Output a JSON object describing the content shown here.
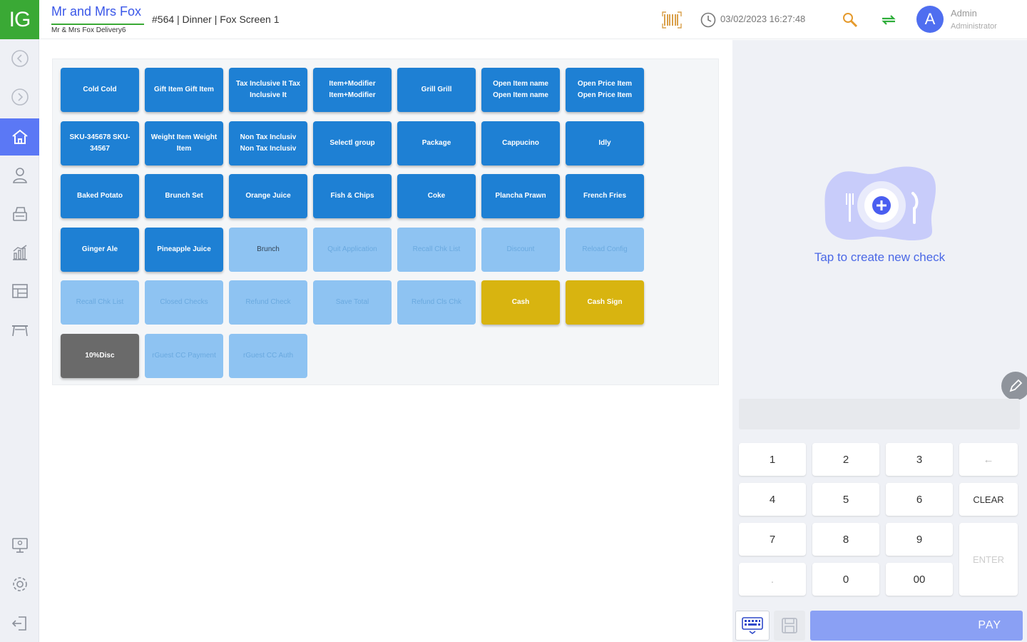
{
  "app": {
    "logo": "IG",
    "store_name": "Mr and Mrs Fox",
    "store_sub": "Mr & Mrs Fox Delivery6",
    "order_info": "#564 | Dinner | Fox Screen 1",
    "datetime": "03/02/2023 16:27:48",
    "avatar_letter": "A",
    "user_name": "Admin",
    "user_role": "Administrator"
  },
  "colors": {
    "brand_green": "#3aa935",
    "accent_blue": "#5b78f5",
    "tile_blue": "#1e80d4",
    "tile_light": "#8ec3f2",
    "tile_gold": "#d8b410",
    "tile_gray": "#6a6a6a"
  },
  "sidebar": {
    "items": [
      {
        "icon": "back-circle-icon"
      },
      {
        "icon": "forward-circle-icon"
      },
      {
        "icon": "home-icon",
        "active": true
      },
      {
        "icon": "user-icon"
      },
      {
        "icon": "register-icon"
      },
      {
        "icon": "reports-icon"
      },
      {
        "icon": "table-layout-icon"
      },
      {
        "icon": "table-icon"
      },
      {
        "icon": "screen-icon"
      },
      {
        "icon": "gear-icon"
      },
      {
        "icon": "logout-icon"
      }
    ]
  },
  "menu": {
    "tiles": [
      {
        "label": "Cold Cold",
        "style": "blue"
      },
      {
        "label": "Gift Item Gift Item",
        "style": "blue"
      },
      {
        "label": "Tax Inclusive It Tax Inclusive It",
        "style": "blue"
      },
      {
        "label": "Item+Modifier Item+Modifier",
        "style": "blue"
      },
      {
        "label": "Grill Grill",
        "style": "blue"
      },
      {
        "label": "Open Item name Open Item name",
        "style": "blue"
      },
      {
        "label": "Open Price Item Open Price Item",
        "style": "blue"
      },
      {
        "label": "SKU-345678 SKU-34567",
        "style": "blue"
      },
      {
        "label": "Weight Item Weight Item",
        "style": "blue"
      },
      {
        "label": "Non Tax Inclusiv Non Tax Inclusiv",
        "style": "blue"
      },
      {
        "label": "Selectl group",
        "style": "blue"
      },
      {
        "label": "Package",
        "style": "blue"
      },
      {
        "label": "Cappucino",
        "style": "blue"
      },
      {
        "label": "Idly",
        "style": "blue"
      },
      {
        "label": "Baked Potato",
        "style": "blue"
      },
      {
        "label": "Brunch Set",
        "style": "blue"
      },
      {
        "label": "Orange Juice",
        "style": "blue"
      },
      {
        "label": "Fish & Chips",
        "style": "blue"
      },
      {
        "label": "Coke",
        "style": "blue"
      },
      {
        "label": "Plancha Prawn",
        "style": "blue"
      },
      {
        "label": "French Fries",
        "style": "blue"
      },
      {
        "label": "Ginger Ale",
        "style": "blue"
      },
      {
        "label": "Pineapple Juice",
        "style": "blue"
      },
      {
        "label": "Brunch",
        "style": "light-dark"
      },
      {
        "label": "Quit Application",
        "style": "light"
      },
      {
        "label": "Recall Chk List",
        "style": "light"
      },
      {
        "label": "Discount",
        "style": "light"
      },
      {
        "label": "Reload Config",
        "style": "light"
      },
      {
        "label": "Recall Chk List",
        "style": "light"
      },
      {
        "label": "Closed Checks",
        "style": "light"
      },
      {
        "label": "Refund Check",
        "style": "light"
      },
      {
        "label": "Save Total",
        "style": "light"
      },
      {
        "label": "Refund Cls Chk",
        "style": "light"
      },
      {
        "label": "Cash",
        "style": "gold"
      },
      {
        "label": "Cash Sign",
        "style": "gold"
      },
      {
        "label": "10%Disc",
        "style": "gray"
      },
      {
        "label": "rGuest CC Payment",
        "style": "light"
      },
      {
        "label": "rGuest CC Auth",
        "style": "light"
      }
    ]
  },
  "check_panel": {
    "empty_text": "Tap to create new check"
  },
  "keypad": {
    "k1": "1",
    "k2": "2",
    "k3": "3",
    "back": "←",
    "k4": "4",
    "k5": "5",
    "k6": "6",
    "clear": "CLEAR",
    "k7": "7",
    "k8": "8",
    "k9": "9",
    "enter": "ENTER",
    "dot": ".",
    "k0": "0",
    "k00": "00"
  },
  "footer": {
    "pay_label": "PAY"
  }
}
